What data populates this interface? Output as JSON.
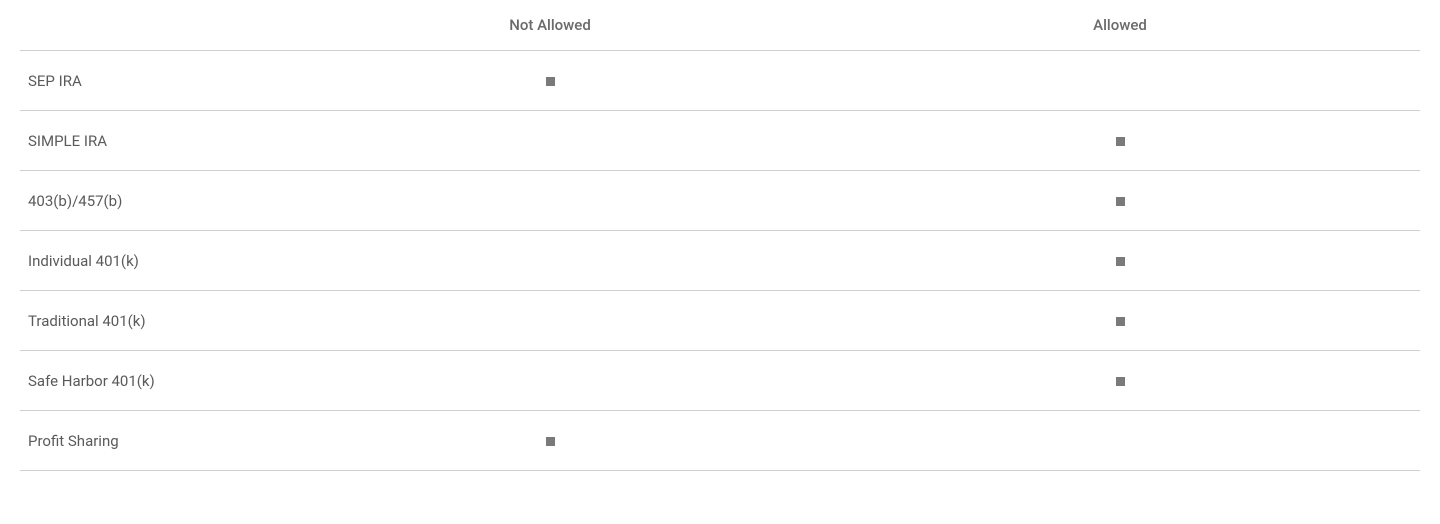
{
  "headers": {
    "label": "",
    "not_allowed": "Not Allowed",
    "allowed": "Allowed"
  },
  "rows": [
    {
      "label": "SEP IRA",
      "not_allowed": true,
      "allowed": false
    },
    {
      "label": "SIMPLE IRA",
      "not_allowed": false,
      "allowed": true
    },
    {
      "label": "403(b)/457(b)",
      "not_allowed": false,
      "allowed": true
    },
    {
      "label": "Individual 401(k)",
      "not_allowed": false,
      "allowed": true
    },
    {
      "label": "Traditional 401(k)",
      "not_allowed": false,
      "allowed": true
    },
    {
      "label": "Safe Harbor 401(k)",
      "not_allowed": false,
      "allowed": true
    },
    {
      "label": "Profit Sharing",
      "not_allowed": true,
      "allowed": false
    }
  ]
}
